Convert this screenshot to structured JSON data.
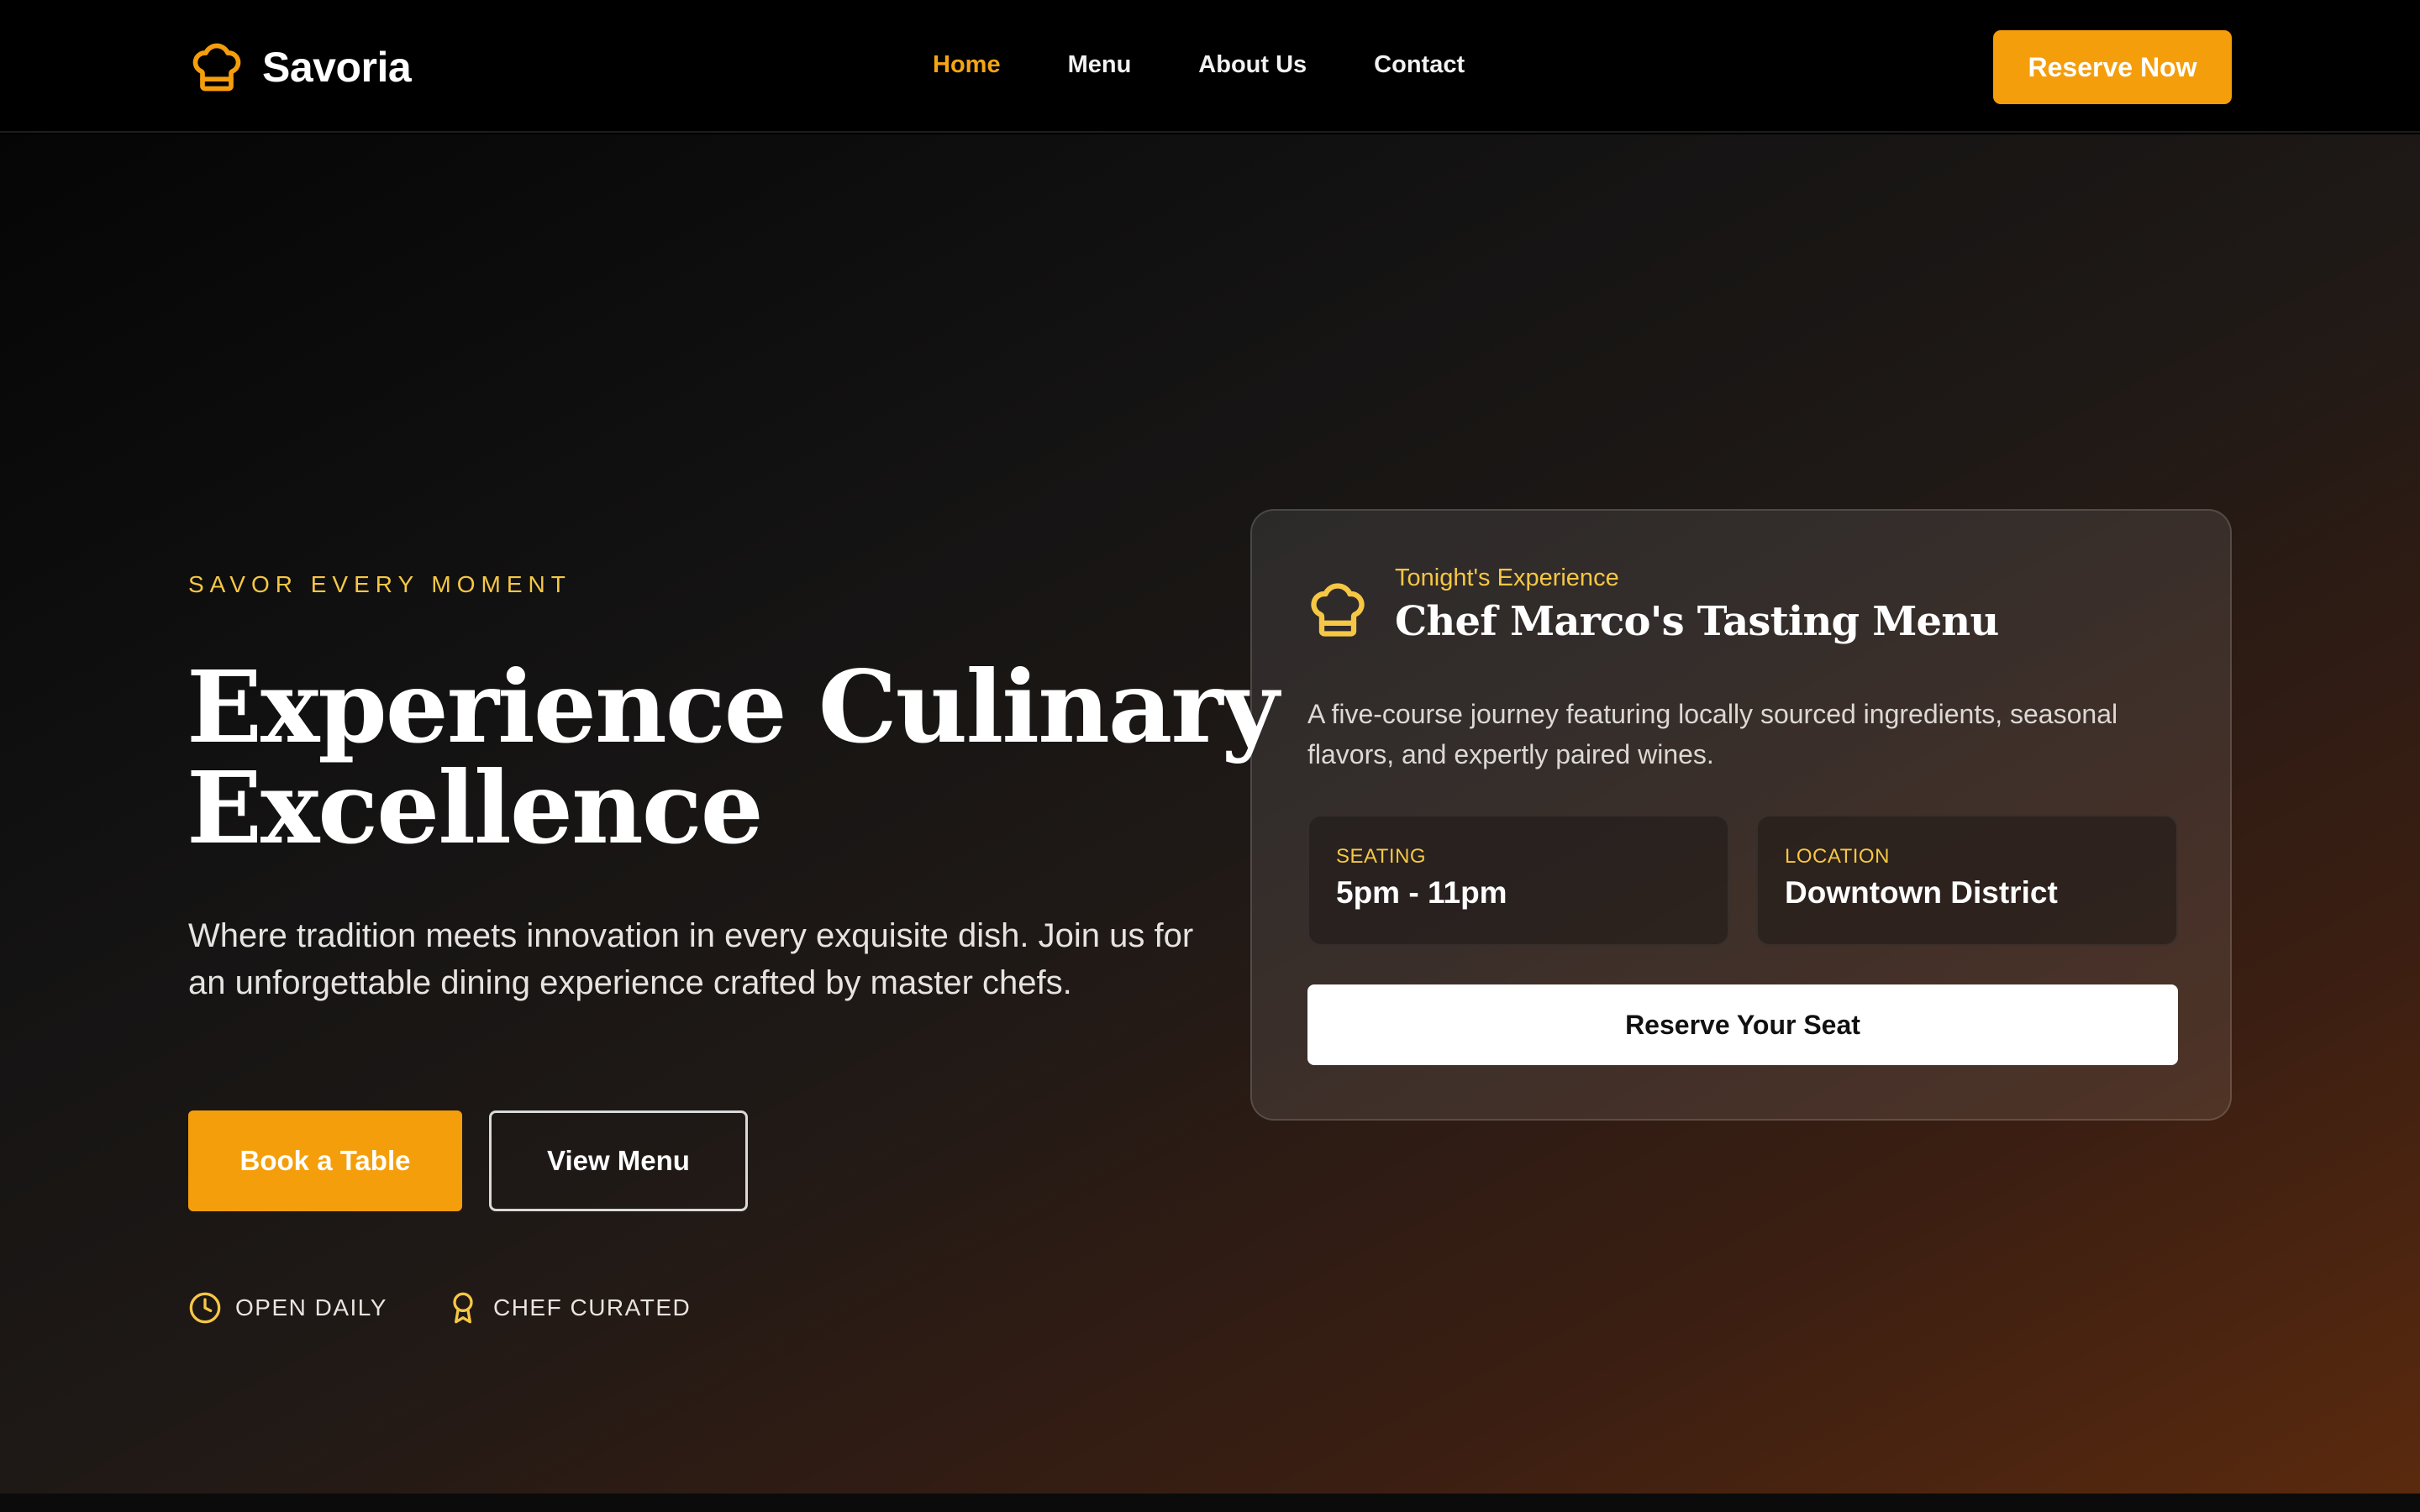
{
  "brand": {
    "name": "Savoria",
    "icon": "chef-hat-icon",
    "accent": "#f59e0b"
  },
  "nav": {
    "links": [
      {
        "label": "Home",
        "active": true
      },
      {
        "label": "Menu",
        "active": false
      },
      {
        "label": "About Us",
        "active": false
      },
      {
        "label": "Contact",
        "active": false
      }
    ],
    "cta_label": "Reserve Now"
  },
  "hero": {
    "eyebrow": "SAVOR EVERY MOMENT",
    "headline_line1": "Experience Culinary",
    "headline_line2": "Excellence",
    "lede": "Where tradition meets innovation in every exquisite dish. Join us for an unforgettable dining experience crafted by master chefs.",
    "primary_button": "Book a Table",
    "secondary_button": "View Menu",
    "badges": [
      {
        "icon": "clock-icon",
        "label": "OPEN DAILY"
      },
      {
        "icon": "award-icon",
        "label": "CHEF CURATED"
      }
    ]
  },
  "card": {
    "icon": "chef-hat-icon",
    "kicker": "Tonight's Experience",
    "title": "Chef Marco's Tasting Menu",
    "description": "A five-course journey featuring locally sourced ingredients, seasonal flavors, and expertly paired wines.",
    "info": [
      {
        "label": "SEATING",
        "value": "5pm - 11pm"
      },
      {
        "label": "LOCATION",
        "value": "Downtown District"
      }
    ],
    "cta_label": "Reserve Your Seat"
  },
  "colors": {
    "accent": "#f59e0b",
    "accent_text": "#f6c744",
    "background": "#000000"
  }
}
